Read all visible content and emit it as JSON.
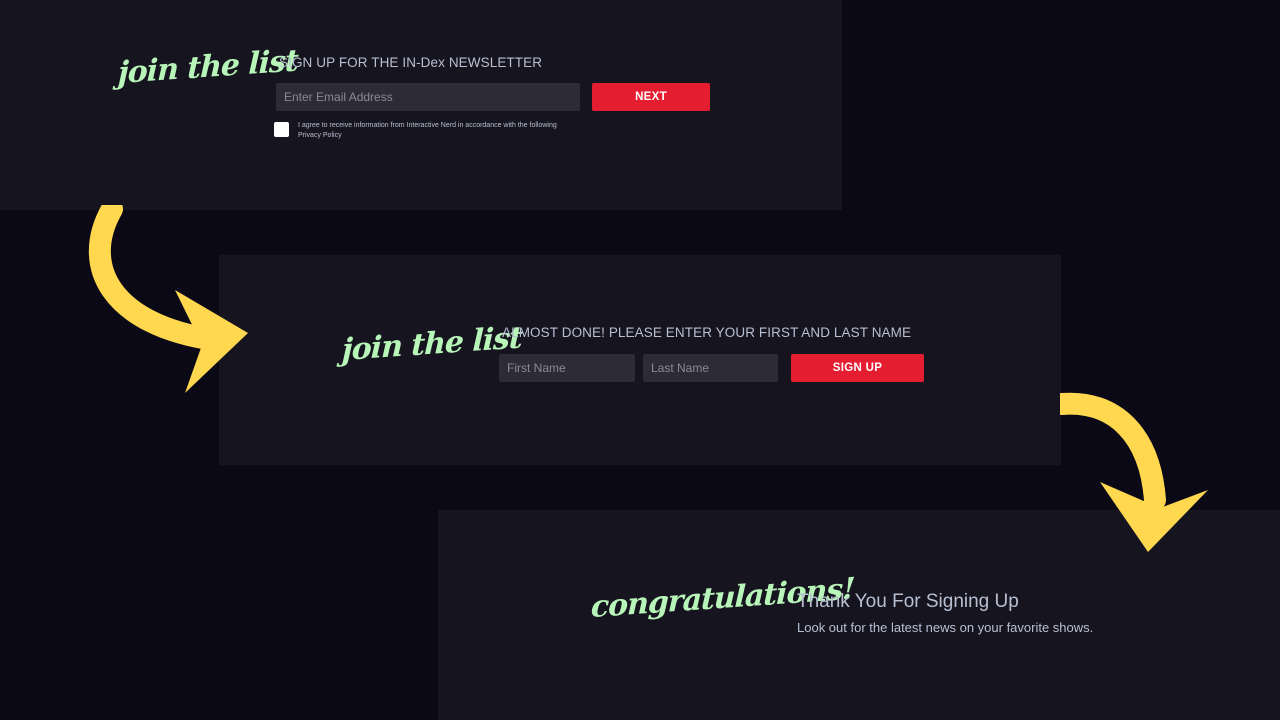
{
  "step1": {
    "script_title": "join the list",
    "heading": "SIGN UP FOR THE IN-Dex NEWSLETTER",
    "email_placeholder": "Enter Email Address",
    "next_label": "NEXT",
    "agree_text": "I agree to receive information from Interactive Nerd in accordance with the following Privacy Policy"
  },
  "step2": {
    "script_title": "join the list",
    "heading": "ALMOST DONE! PLEASE ENTER YOUR FIRST AND LAST NAME",
    "first_name_placeholder": "First Name",
    "last_name_placeholder": "Last Name",
    "signup_label": "SIGN UP"
  },
  "step3": {
    "script_title": "congratulations!",
    "heading": "Thank You For Signing Up",
    "subtext": "Look out for the latest news on your favorite shows."
  },
  "colors": {
    "background": "#0b0916",
    "panel": "#16151f",
    "accent_red": "#e51d31",
    "script_green": "#b8f5b8",
    "arrow_yellow": "#ffd84f"
  },
  "icons": [
    "curved-arrow-icon",
    "curved-arrow-icon"
  ]
}
